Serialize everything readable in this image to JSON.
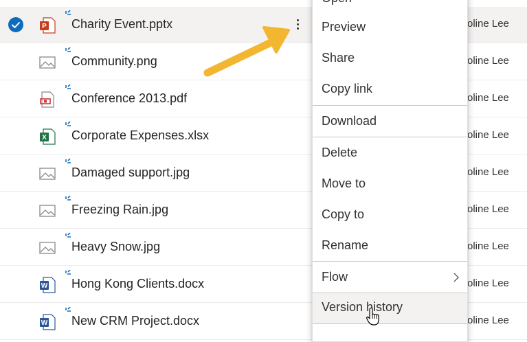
{
  "files": [
    {
      "name": "Charity Event.pptx",
      "type": "pptx",
      "modified_by": "oline Lee",
      "selected": true
    },
    {
      "name": "Community.png",
      "type": "image",
      "modified_by": "oline Lee",
      "selected": false
    },
    {
      "name": "Conference 2013.pdf",
      "type": "pdf",
      "modified_by": "oline Lee",
      "selected": false
    },
    {
      "name": "Corporate Expenses.xlsx",
      "type": "xlsx",
      "modified_by": "oline Lee",
      "selected": false
    },
    {
      "name": "Damaged support.jpg",
      "type": "image",
      "modified_by": "oline Lee",
      "selected": false
    },
    {
      "name": "Freezing Rain.jpg",
      "type": "image",
      "modified_by": "oline Lee",
      "selected": false
    },
    {
      "name": "Heavy Snow.jpg",
      "type": "image",
      "modified_by": "oline Lee",
      "selected": false
    },
    {
      "name": "Hong Kong Clients.docx",
      "type": "docx",
      "modified_by": "oline Lee",
      "selected": false
    },
    {
      "name": "New CRM Project.docx",
      "type": "docx",
      "modified_by": "oline Lee",
      "selected": false
    }
  ],
  "context_menu": {
    "items": [
      {
        "label": "Open",
        "id": "open"
      },
      {
        "label": "Preview",
        "id": "preview"
      },
      {
        "label": "Share",
        "id": "share"
      },
      {
        "label": "Copy link",
        "id": "copy-link"
      },
      {
        "label": "Download",
        "id": "download"
      },
      {
        "label": "Delete",
        "id": "delete"
      },
      {
        "label": "Move to",
        "id": "move-to"
      },
      {
        "label": "Copy to",
        "id": "copy-to"
      },
      {
        "label": "Rename",
        "id": "rename"
      },
      {
        "label": "Flow",
        "id": "flow",
        "has_submenu": true
      },
      {
        "label": "Version history",
        "id": "version-history",
        "hovered": true
      }
    ]
  },
  "colors": {
    "accent": "#0f6cbd",
    "arrow": "#f2b630",
    "pptx": "#c43e1c",
    "xlsx": "#217346",
    "docx": "#2b579a",
    "pdf": "#d13438",
    "image": "#8a8886",
    "new_indicator": "#0f6cbd"
  }
}
